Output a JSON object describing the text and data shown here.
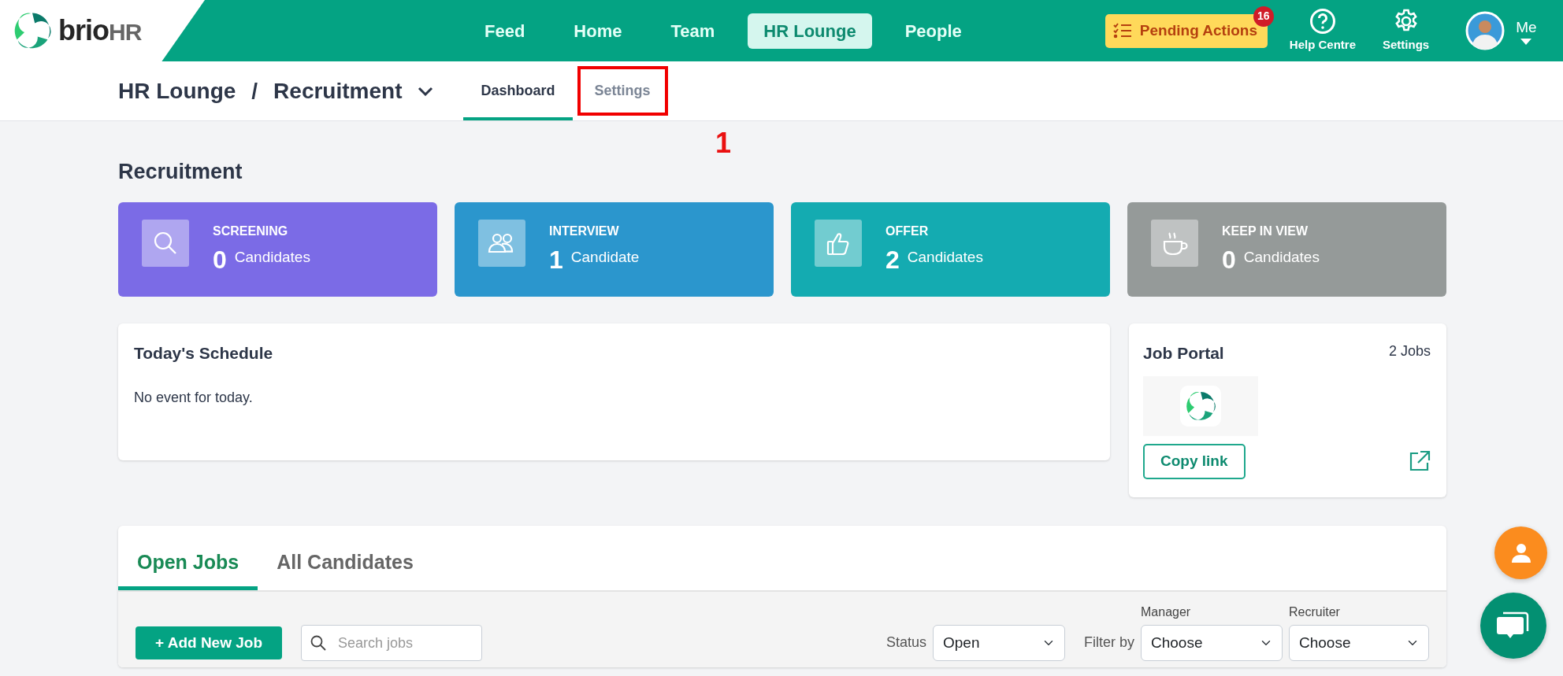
{
  "brand": {
    "word": "brio",
    "suffix": "HR"
  },
  "nav": [
    {
      "label": "Feed",
      "selected": false
    },
    {
      "label": "Home",
      "selected": false
    },
    {
      "label": "Team",
      "selected": false
    },
    {
      "label": "HR Lounge",
      "selected": true
    },
    {
      "label": "People",
      "selected": false
    }
  ],
  "pending_actions": {
    "label": "Pending Actions",
    "count": "16"
  },
  "utilities": [
    {
      "label": "Help Centre",
      "kind": "help"
    },
    {
      "label": "Settings",
      "kind": "settings"
    }
  ],
  "profile": {
    "label": "Me"
  },
  "breadcrumb": {
    "items": [
      "HR Lounge",
      "Recruitment"
    ],
    "separator": "/"
  },
  "subtabs": [
    {
      "label": "Dashboard",
      "selected": true,
      "highlighted": false
    },
    {
      "label": "Settings",
      "selected": false,
      "highlighted": true
    }
  ],
  "annotation": {
    "label": "1"
  },
  "page_title": "Recruitment",
  "stages": [
    {
      "title": "SCREENING",
      "count": "0",
      "unit": "Candidates",
      "kind": "search",
      "color": "#7b6be6"
    },
    {
      "title": "INTERVIEW",
      "count": "1",
      "unit": "Candidate",
      "kind": "people",
      "color": "#2b96cd"
    },
    {
      "title": "OFFER",
      "count": "2",
      "unit": "Candidates",
      "kind": "thumb",
      "color": "#14abb1"
    },
    {
      "title": "KEEP IN VIEW",
      "count": "0",
      "unit": "Candidates",
      "kind": "cup",
      "color": "#959a99"
    }
  ],
  "schedule": {
    "title": "Today's Schedule",
    "empty_text": "No event for today."
  },
  "job_portal": {
    "title": "Job Portal",
    "count": "2 Jobs",
    "button": "Copy link"
  },
  "jobs_tabs": [
    {
      "label": "Open Jobs",
      "selected": true
    },
    {
      "label": "All Candidates",
      "selected": false
    }
  ],
  "toolbar": {
    "add_button": "+ Add New Job",
    "search_placeholder": "Search jobs",
    "status_label": "Status",
    "status_value": "Open",
    "filter_label": "Filter by",
    "filters": [
      {
        "label": "Manager",
        "value": "Choose"
      },
      {
        "label": "Recruiter",
        "value": "Choose"
      }
    ]
  }
}
